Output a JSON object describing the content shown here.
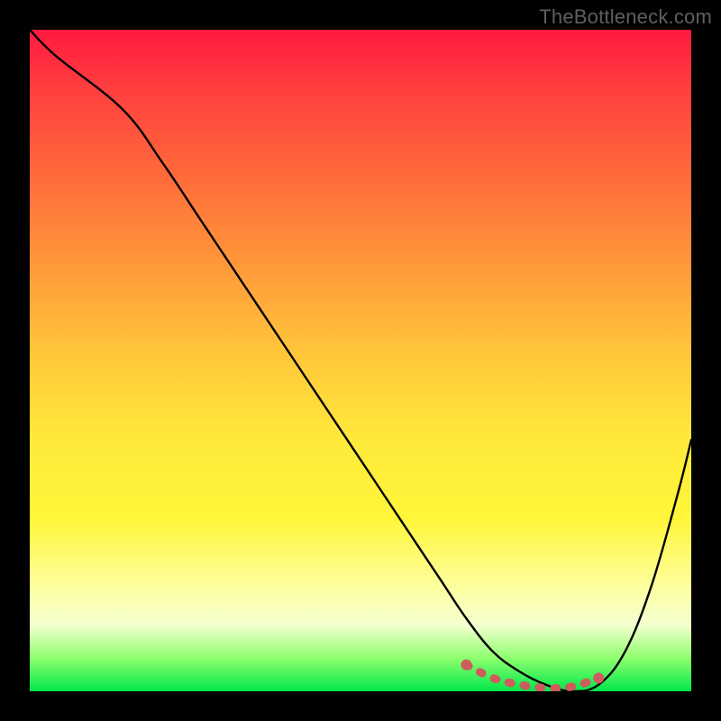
{
  "attribution": "TheBottleneck.com",
  "chart_data": {
    "type": "line",
    "title": "",
    "xlabel": "",
    "ylabel": "",
    "xlim": [
      0,
      100
    ],
    "ylim": [
      0,
      100
    ],
    "series": [
      {
        "name": "curve",
        "x": [
          0,
          4,
          14,
          20,
          26,
          32,
          38,
          44,
          50,
          56,
          62,
          66,
          70,
          74,
          78,
          82,
          86,
          90,
          94,
          98,
          100
        ],
        "y": [
          100,
          96,
          88,
          80,
          71,
          62,
          53,
          44,
          35,
          26,
          17,
          11,
          6,
          3,
          1,
          0,
          1,
          6,
          16,
          30,
          38
        ]
      }
    ],
    "highlight": {
      "name": "bottom-valley-marker",
      "color": "#cd5c5c",
      "x": [
        66,
        70,
        74,
        78,
        82,
        86
      ],
      "y": [
        4,
        2,
        1,
        0.5,
        0.7,
        2
      ]
    },
    "annotations": []
  }
}
